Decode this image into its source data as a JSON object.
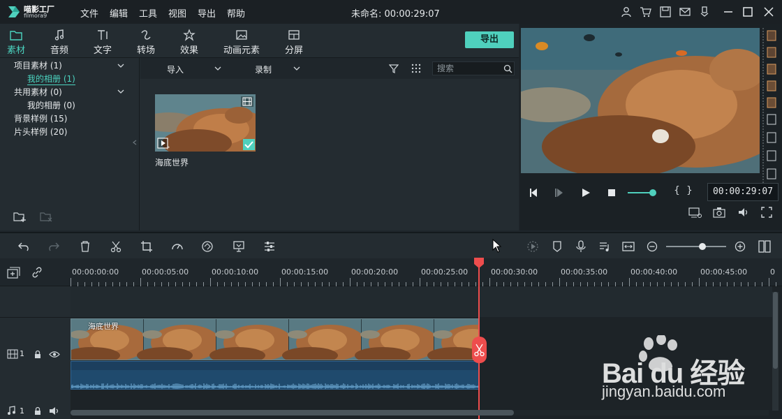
{
  "app": {
    "logo_text": "喵影工厂",
    "logo_sub": "filmora9",
    "title": "未命名: 00:00:29:07"
  },
  "menu": [
    "文件",
    "编辑",
    "工具",
    "视图",
    "导出",
    "帮助"
  ],
  "tabs": [
    {
      "label": "素材",
      "icon": "folder-icon",
      "active": true
    },
    {
      "label": "音频",
      "icon": "music-note-icon"
    },
    {
      "label": "文字",
      "icon": "text-icon"
    },
    {
      "label": "转场",
      "icon": "transition-icon"
    },
    {
      "label": "效果",
      "icon": "effects-icon"
    },
    {
      "label": "动画元素",
      "icon": "image-icon"
    },
    {
      "label": "分屏",
      "icon": "split-screen-icon"
    }
  ],
  "export_label": "导出",
  "tree": [
    {
      "label": "项目素材 (1)"
    },
    {
      "label": "我的相册 (1)"
    },
    {
      "label": "共用素材 (0)"
    },
    {
      "label": "我的相册 (0)"
    },
    {
      "label": "背景样例 (15)"
    },
    {
      "label": "片头样例 (20)"
    }
  ],
  "media_toolbar": {
    "import_label": "导入",
    "record_label": "录制",
    "search_placeholder": "搜索"
  },
  "media_items": [
    {
      "label": "海底世界"
    }
  ],
  "preview": {
    "timecode": "00:00:29:07",
    "volume": 0.8
  },
  "timeline": {
    "ruler": [
      "00:00:00:00",
      "00:00:05:00",
      "00:00:10:00",
      "00:00:15:00",
      "00:00:20:00",
      "00:00:25:00",
      "00:00:30:00",
      "00:00:35:00",
      "00:00:40:00",
      "00:00:45:00",
      "0"
    ],
    "video_track_label": "1",
    "audio_track_label": "1",
    "video_clip_label": "海底世界",
    "zoom": 0.6
  },
  "watermark": {
    "brand": "Bai du 经验",
    "url": "jingyan.baidu.com"
  },
  "colors": {
    "accent": "#4fd0bd",
    "playhead": "#ee4d4d",
    "background": "#242c31"
  }
}
